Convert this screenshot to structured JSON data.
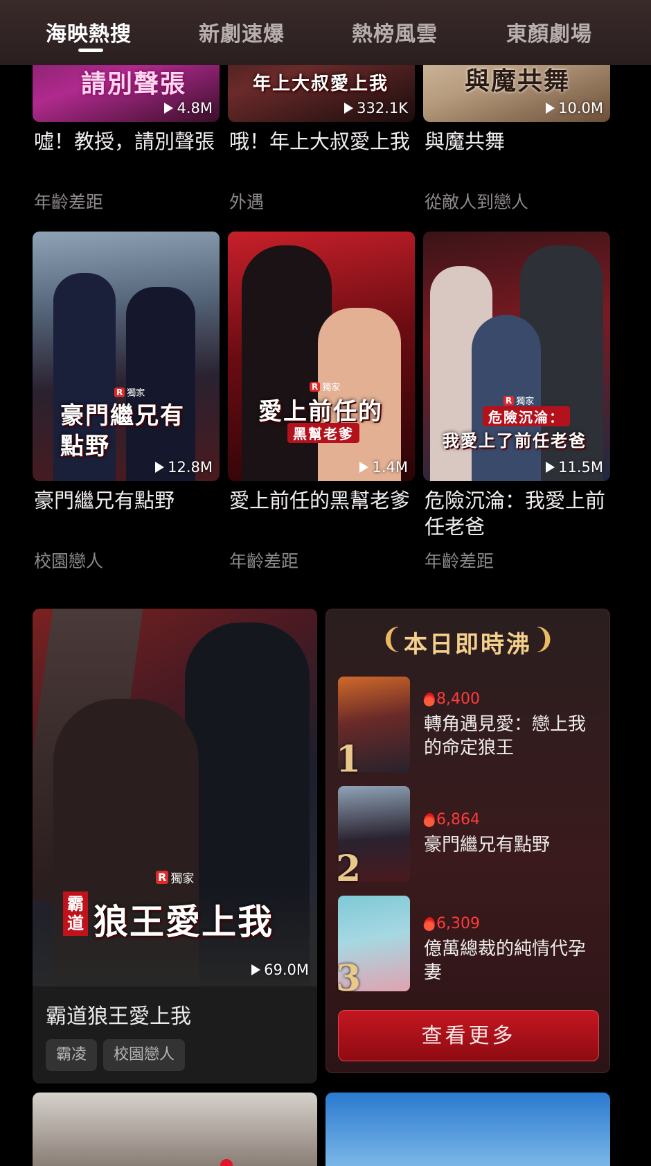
{
  "tabs": [
    {
      "label": "海映熱搜",
      "active": true
    },
    {
      "label": "新劇速爆",
      "active": false
    },
    {
      "label": "熱榜風雲",
      "active": false
    },
    {
      "label": "東顏劇場",
      "active": false
    }
  ],
  "row1": [
    {
      "poster_text": "請別聲張",
      "views": "4.8M",
      "title": "噓！教授，請別聲張",
      "genre": "年齡差距"
    },
    {
      "poster_text": "年上大叔愛上我",
      "views": "332.1K",
      "title": "哦！年上大叔愛上我",
      "genre": "外遇"
    },
    {
      "poster_text": "與魔共舞",
      "views": "10.0M",
      "title": "與魔共舞",
      "genre": "從敵人到戀人"
    }
  ],
  "row2": [
    {
      "poster_text": "豪門繼兄有點野",
      "badge": "獨家",
      "views": "12.8M",
      "title": "豪門繼兄有點野",
      "genre": "校園戀人"
    },
    {
      "poster_text": "愛上前任的",
      "poster_sub": "黑幫老爹",
      "badge": "獨家",
      "views": "1.4M",
      "title": "愛上前任的黑幫老爹",
      "genre": "年齡差距"
    },
    {
      "poster_text": "我愛上了前任老爸",
      "poster_sub": "危險沉淪：",
      "badge": "獨家",
      "views": "11.5M",
      "title": "危險沉淪：我愛上前任老爸",
      "genre": "年齡差距"
    }
  ],
  "feature": {
    "badge": "獨家",
    "poster_tag": "霸道",
    "poster_text": "狼王愛上我",
    "views": "69.0M",
    "title": "霸道狼王愛上我",
    "tags": [
      "霸凌",
      "校園戀人"
    ]
  },
  "ranking": {
    "heading": "本日即時沸",
    "items": [
      {
        "rank": "1",
        "heat": "8,400",
        "title": "轉角遇見愛：戀上我的命定狼王"
      },
      {
        "rank": "2",
        "heat": "6,864",
        "title": "豪門繼兄有點野"
      },
      {
        "rank": "3",
        "heat": "6,309",
        "title": "億萬總裁的純情代孕妻"
      }
    ],
    "more_label": "查看更多"
  },
  "colors": {
    "accent_red": "#c4161f",
    "gold": "#f4d08c",
    "heat_red": "#ff3b3b"
  }
}
